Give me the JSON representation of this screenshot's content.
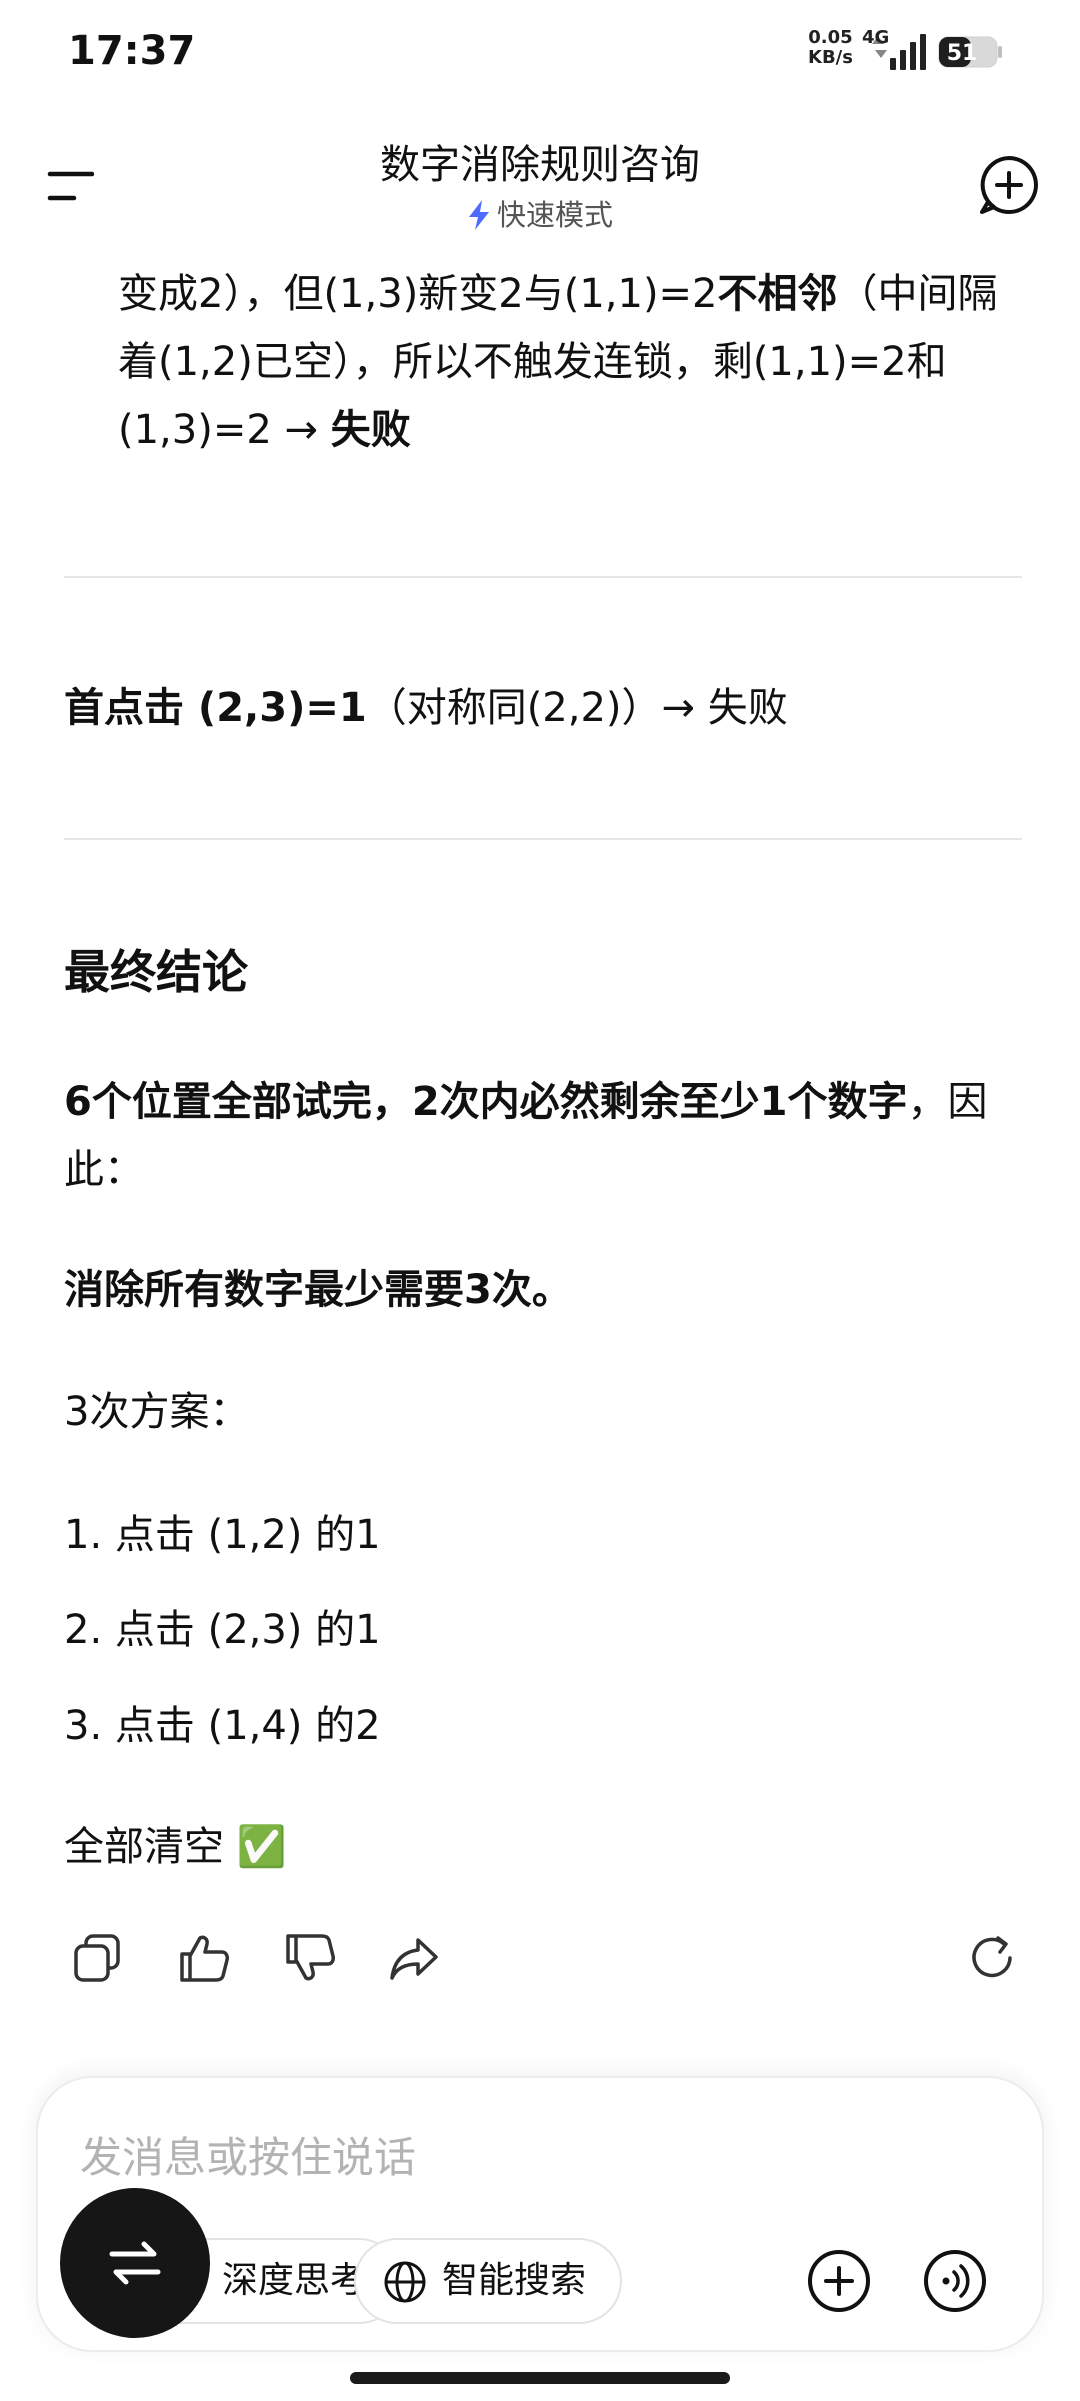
{
  "status_bar": {
    "time": "17:37",
    "net_speed_value": "0.05",
    "net_speed_unit": "KB/s",
    "network_type": "4G",
    "battery_level": "51"
  },
  "header": {
    "title": "数字消除规则咨询",
    "mode": "快速模式",
    "menu_icon": "menu-icon",
    "new_chat_icon": "plus-chat-icon"
  },
  "message": {
    "top_fragment_cut": "…",
    "para1_a": "变成2），但(1,3)新变2与(1,1)=2",
    "para1_bold1": "不相邻",
    "para1_b": "（中间隔着(1,2)已空），所以不触发连锁，剩(1,1)=2和(1,3)=2 → ",
    "para1_bold2": "失败",
    "para2_bold": "首点击 (2,3)=1",
    "para2_rest": "（对称同(2,2)）→ 失败",
    "heading": "最终结论",
    "para3_bold": "6个位置全部试完，2次内必然剩余至少1个数字",
    "para3_rest": "，因此：",
    "para4_bold": "消除所有数字最少需要3次。",
    "para5": "3次方案：",
    "steps": [
      "1. 点击 (1,2) 的1",
      "2. 点击 (2,3) 的1",
      "3. 点击 (1,4) 的2"
    ],
    "final": "全部清空 ✅"
  },
  "actions": {
    "copy": "copy-icon",
    "like": "thumbs-up-icon",
    "dislike": "thumbs-down-icon",
    "share": "share-icon",
    "regenerate": "refresh-icon"
  },
  "input": {
    "placeholder": "发消息或按住说话",
    "deep_think": "深度思考",
    "smart_search": "智能搜索"
  },
  "colors": {
    "accent": "#4f6bff",
    "text": "#111111",
    "placeholder": "#b3b3b3"
  }
}
